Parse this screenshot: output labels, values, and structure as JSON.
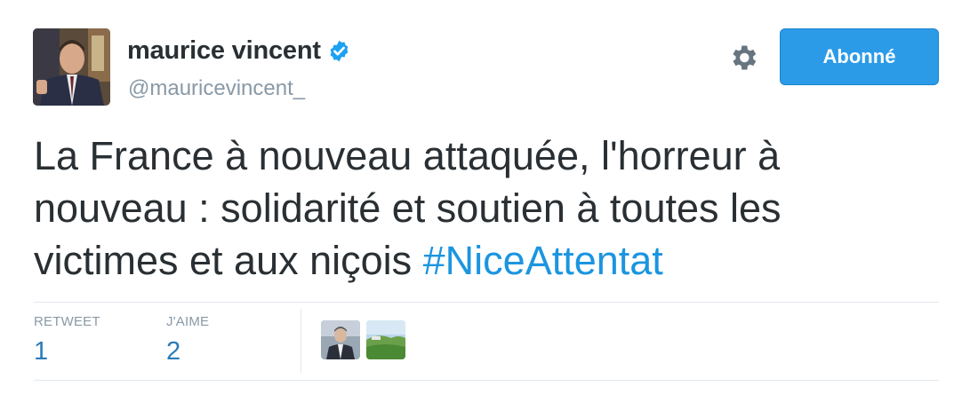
{
  "author": {
    "display_name": "maurice vincent",
    "handle": "@mauricevincent_",
    "verified": true
  },
  "actions": {
    "follow_label": "Abonné"
  },
  "tweet": {
    "text_lines": [
      "La France à nouveau attaquée, l'horreur à",
      "nouveau : solidarité et soutien à toutes les",
      "victimes et aux niçois "
    ],
    "hashtag": "#NiceAttentat"
  },
  "stats": {
    "retweet_label": "RETWEET",
    "retweet_count": "1",
    "like_label": "J'AIME",
    "like_count": "2"
  },
  "likers": [
    {
      "avatar": "man-in-suit-avatar"
    },
    {
      "avatar": "landscape-avatar"
    }
  ],
  "colors": {
    "accent": "#2b9be8",
    "link": "#1b95e0",
    "text": "#292f33",
    "muted": "#8899a6",
    "verified_badge": "#1da1f2"
  }
}
